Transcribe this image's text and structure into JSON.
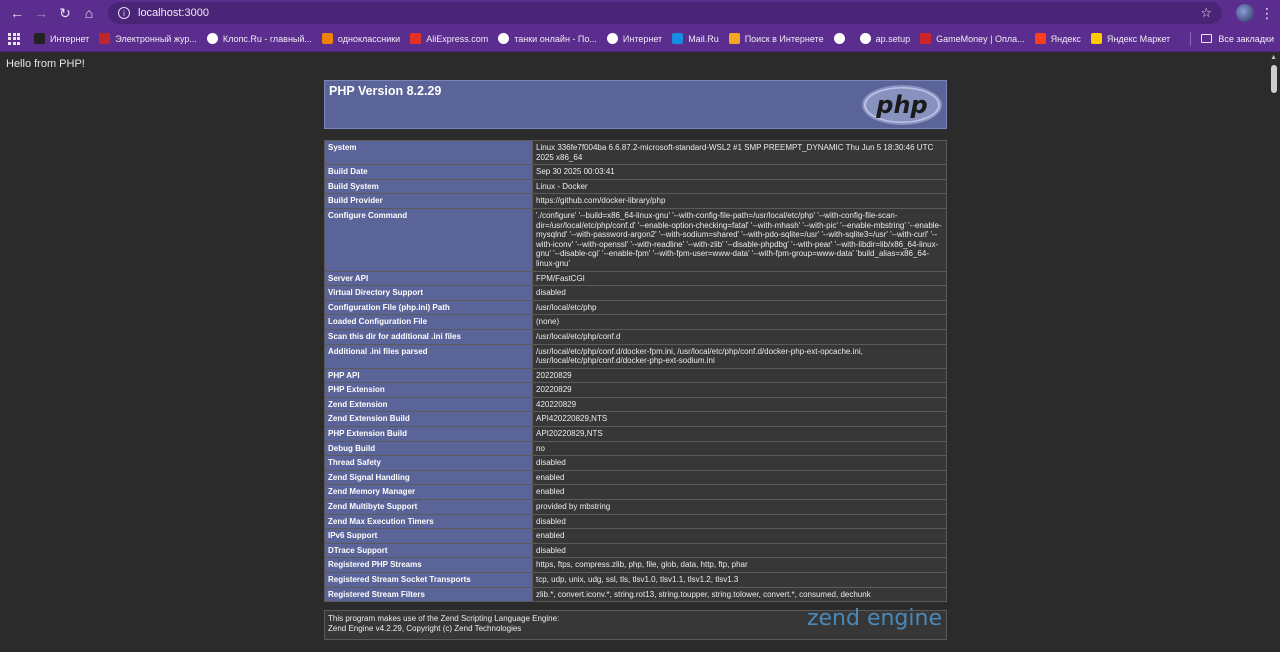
{
  "browser": {
    "url": "localhost:3000",
    "bookmarks": [
      {
        "label": "Интернет",
        "icon": "ya-icon",
        "color": "#222222"
      },
      {
        "label": "Электронный жур...",
        "icon": "journal-icon",
        "color": "#c0262d"
      },
      {
        "label": "Клопс.Ru - главный...",
        "icon": "klops-icon",
        "color": "#ffffff"
      },
      {
        "label": "одноклассники",
        "icon": "ok-icon",
        "color": "#ee8208"
      },
      {
        "label": "AliExpress.com",
        "icon": "aliexpress-icon",
        "color": "#e43225"
      },
      {
        "label": "танки онлайн - По...",
        "icon": "google-icon",
        "color": "#ffffff"
      },
      {
        "label": "Интернет",
        "icon": "globe-icon",
        "color": "#ffffff"
      },
      {
        "label": "Mail.Ru",
        "icon": "mailru-icon",
        "color": "#168de2"
      },
      {
        "label": "Поиск в Интернете",
        "icon": "search-engine-icon",
        "color": "#f5a623"
      },
      {
        "label": "",
        "icon": "globe-icon",
        "color": "#ffffff"
      },
      {
        "label": "ap.setup",
        "icon": "globe-icon",
        "color": "#ffffff"
      },
      {
        "label": "GameMoney | Опла...",
        "icon": "gamemoney-icon",
        "color": "#d0242b"
      },
      {
        "label": "Яндекс",
        "icon": "yandex-icon",
        "color": "#fc3f1d"
      },
      {
        "label": "Яндекс Маркет",
        "icon": "yandex-market-icon",
        "color": "#ffcc00"
      }
    ],
    "all_bookmarks_label": "Все закладки"
  },
  "page": {
    "hello": "Hello from PHP!",
    "version_title": "PHP Version 8.2.29",
    "rows": [
      {
        "key": "System",
        "value": "Linux 336fe7f004ba 6.6.87.2-microsoft-standard-WSL2 #1 SMP PREEMPT_DYNAMIC Thu Jun 5 18:30:46 UTC 2025 x86_64"
      },
      {
        "key": "Build Date",
        "value": "Sep 30 2025 00:03:41"
      },
      {
        "key": "Build System",
        "value": "Linux - Docker"
      },
      {
        "key": "Build Provider",
        "value": "https://github.com/docker-library/php"
      },
      {
        "key": "Configure Command",
        "value": "'./configure' '--build=x86_64-linux-gnu' '--with-config-file-path=/usr/local/etc/php' '--with-config-file-scan-dir=/usr/local/etc/php/conf.d' '--enable-option-checking=fatal' '--with-mhash' '--with-pic' '--enable-mbstring' '--enable-mysqlnd' '--with-password-argon2' '--with-sodium=shared' '--with-pdo-sqlite=/usr' '--with-sqlite3=/usr' '--with-curl' '--with-iconv' '--with-openssl' '--with-readline' '--with-zlib' '--disable-phpdbg' '--with-pear' '--with-libdir=lib/x86_64-linux-gnu' '--disable-cgi' '--enable-fpm' '--with-fpm-user=www-data' '--with-fpm-group=www-data' 'build_alias=x86_64-linux-gnu'"
      },
      {
        "key": "Server API",
        "value": "FPM/FastCGI"
      },
      {
        "key": "Virtual Directory Support",
        "value": "disabled"
      },
      {
        "key": "Configuration File (php.ini) Path",
        "value": "/usr/local/etc/php"
      },
      {
        "key": "Loaded Configuration File",
        "value": "(none)"
      },
      {
        "key": "Scan this dir for additional .ini files",
        "value": "/usr/local/etc/php/conf.d"
      },
      {
        "key": "Additional .ini files parsed",
        "value": "/usr/local/etc/php/conf.d/docker-fpm.ini, /usr/local/etc/php/conf.d/docker-php-ext-opcache.ini, /usr/local/etc/php/conf.d/docker-php-ext-sodium.ini"
      },
      {
        "key": "PHP API",
        "value": "20220829"
      },
      {
        "key": "PHP Extension",
        "value": "20220829"
      },
      {
        "key": "Zend Extension",
        "value": "420220829"
      },
      {
        "key": "Zend Extension Build",
        "value": "API420220829,NTS"
      },
      {
        "key": "PHP Extension Build",
        "value": "API20220829,NTS"
      },
      {
        "key": "Debug Build",
        "value": "no"
      },
      {
        "key": "Thread Safety",
        "value": "disabled"
      },
      {
        "key": "Zend Signal Handling",
        "value": "enabled"
      },
      {
        "key": "Zend Memory Manager",
        "value": "enabled"
      },
      {
        "key": "Zend Multibyte Support",
        "value": "provided by mbstring"
      },
      {
        "key": "Zend Max Execution Timers",
        "value": "disabled"
      },
      {
        "key": "IPv6 Support",
        "value": "enabled"
      },
      {
        "key": "DTrace Support",
        "value": "disabled"
      },
      {
        "key": "Registered PHP Streams",
        "value": "https, ftps, compress.zlib, php, file, glob, data, http, ftp, phar"
      },
      {
        "key": "Registered Stream Socket Transports",
        "value": "tcp, udp, unix, udg, ssl, tls, tlsv1.0, tlsv1.1, tlsv1.2, tlsv1.3"
      },
      {
        "key": "Registered Stream Filters",
        "value": "zlib.*, convert.iconv.*, string.rot13, string.toupper, string.tolower, convert.*, consumed, dechunk"
      }
    ],
    "zend_line1": "This program makes use of the Zend Scripting Language Engine:",
    "zend_line2": "Zend Engine v4.2.29, Copyright (c) Zend Technologies",
    "zend_logo": "zend engine"
  }
}
